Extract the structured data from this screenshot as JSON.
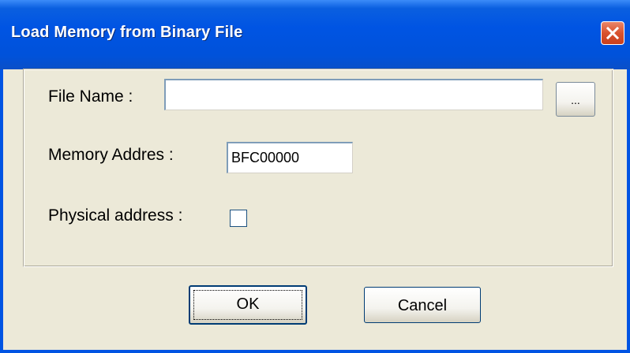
{
  "window": {
    "title": "Load Memory from Binary File",
    "close_icon": "close-icon",
    "accent_color": "#0054E3",
    "background_color": "#ECE9D8"
  },
  "form": {
    "file_name_label": "File Name :",
    "file_name_value": "",
    "browse_label": "...",
    "memory_address_label": "Memory Addres :",
    "memory_address_value": "BFC00000",
    "physical_address_label": "Physical address :",
    "physical_address_checked": false
  },
  "buttons": {
    "ok_label": "OK",
    "cancel_label": "Cancel"
  }
}
